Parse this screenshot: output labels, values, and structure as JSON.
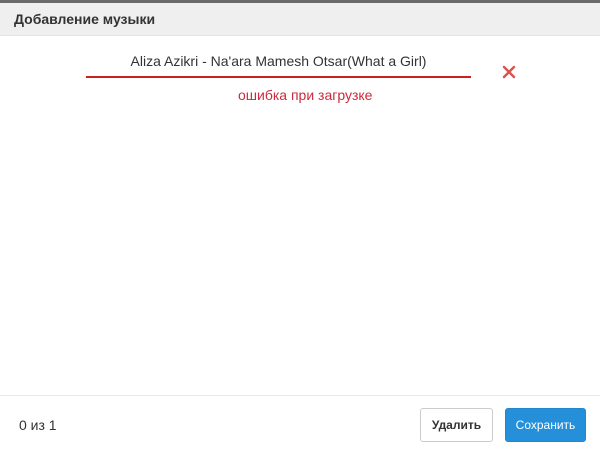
{
  "dialog": {
    "title": "Добавление музыки"
  },
  "upload": {
    "track_name": "Aliza Azikri - Na'ara Mamesh Otsar(What a Girl)",
    "error_message": "ошибка при загрузке",
    "remove_icon": "close-x-icon"
  },
  "footer": {
    "counter": "0 из 1",
    "delete_label": "Удалить",
    "save_label": "Сохранить"
  },
  "colors": {
    "accent": "#2590d9",
    "error": "#cc2a3c",
    "underline": "#cc1f1f"
  }
}
